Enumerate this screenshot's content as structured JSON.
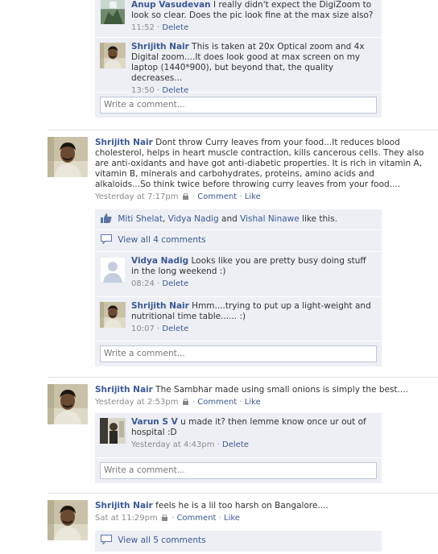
{
  "actions": {
    "delete": "Delete",
    "comment": "Comment",
    "like": "Like",
    "write_placeholder": "Write a comment..."
  },
  "thread1": {
    "comments": [
      {
        "author": "Anup Vasudevan",
        "text": "I really didn't expect the DigiZoom to look so clear. Does the pic look fine at the max size also?",
        "time": "11:52"
      },
      {
        "author": "Shrijith Nair",
        "text": "This is taken at 20x Optical zoom and 4x Digital zoom....It does look good at max screen on my laptop (1440*900), but beyond that, the quality decreases...",
        "time": "13:50"
      }
    ]
  },
  "post2": {
    "author": "Shrijith Nair",
    "text": "Dont throw Curry leaves from your food...It reduces blood cholesterol, helps in heart muscle contraction, kills cancerous cells. They also are anti-oxidants and have got anti-diabetic properties. It is rich in vitamin A, vitamin B, minerals and carbohydrates, proteins, amino acids and alkaloids...So think twice before throwing curry leaves from your food....",
    "time": "Yesterday at 7:17pm",
    "likes": {
      "names": [
        "Miti Shelat",
        "Vidya Nadig",
        "Vishal Ninawe"
      ],
      "sep1": ", ",
      "sep2": " and ",
      "suffix": " like this."
    },
    "view_all": "View all 4 comments",
    "comments": [
      {
        "author": "Vidya Nadig",
        "text": "Looks like you are pretty busy doing stuff in the long weekend :)",
        "time": "08:24"
      },
      {
        "author": "Shrijith Nair",
        "text": "Hmm....trying to put up a light-weight and nutritional time table...... :)",
        "time": "10:07"
      }
    ]
  },
  "post3": {
    "author": "Shrijith Nair",
    "text": "The Sambhar made using small onions is simply the best....",
    "time": "Yesterday at 2:53pm",
    "comments": [
      {
        "author": "Varun S V",
        "text": "u made it? then lemme know once ur out of hospital :D",
        "time": "Yesterday at 4:43pm"
      }
    ]
  },
  "post4": {
    "author": "Shrijith Nair",
    "text": "feels he is a lil too harsh on Bangalore....",
    "time": "Sat at 11:29pm",
    "view_all": "View all 5 comments"
  }
}
